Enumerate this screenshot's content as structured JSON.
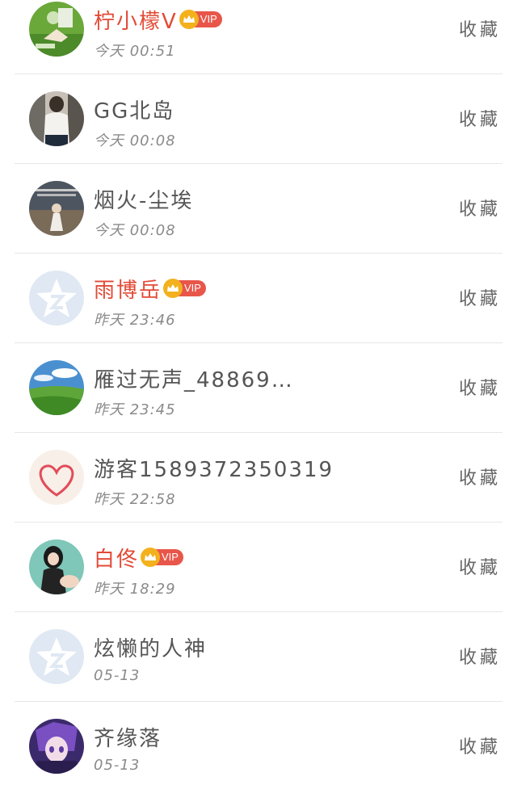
{
  "fav_label": "收藏",
  "vip_label": "VIP",
  "items": [
    {
      "name": "柠小檬V",
      "time": "今天 00:51",
      "vip": true
    },
    {
      "name": "GG北岛",
      "time": "今天 00:08",
      "vip": false
    },
    {
      "name": "烟火-尘埃",
      "time": "今天 00:08",
      "vip": false
    },
    {
      "name": "雨博岳",
      "time": "昨天 23:46",
      "vip": true
    },
    {
      "name": "雁过无声_48869…",
      "time": "昨天 23:45",
      "vip": false
    },
    {
      "name": "游客1589372350319",
      "time": "昨天 22:58",
      "vip": false
    },
    {
      "name": "白佟",
      "time": "昨天 18:29",
      "vip": true
    },
    {
      "name": "炫懒的人神",
      "time": "05-13",
      "vip": false
    },
    {
      "name": "齐缘落",
      "time": "05-13",
      "vip": false
    }
  ],
  "colors": {
    "vip_name": "#e34a36",
    "vip_badge": "#e8564a",
    "crown": "#f3b11d",
    "default_avatar": "#dfe8f3"
  }
}
